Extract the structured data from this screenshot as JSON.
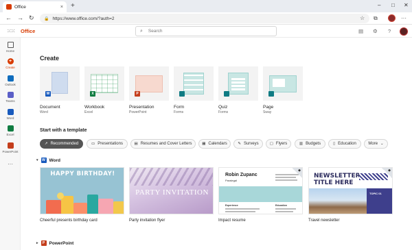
{
  "browser": {
    "tab_title": "Office",
    "url": "https://www.office.com/?auth=2",
    "new_tab": "+",
    "close_tab": "×",
    "window_min": "–",
    "window_max": "□",
    "window_close": "✕",
    "back": "←",
    "forward": "→",
    "refresh": "↻"
  },
  "header": {
    "brand": "Office",
    "search_placeholder": "Search",
    "help": "?"
  },
  "rail": [
    {
      "label": "Home",
      "icon": "home-icon"
    },
    {
      "label": "Create",
      "icon": "create-icon",
      "active": true
    },
    {
      "label": "Outlook",
      "icon": "outlook-icon",
      "color": "#0f6cbd"
    },
    {
      "label": "Teams",
      "icon": "teams-icon",
      "color": "#5b5fc7"
    },
    {
      "label": "Word",
      "icon": "word-icon",
      "color": "#185abd"
    },
    {
      "label": "Excel",
      "icon": "excel-icon",
      "color": "#107c41"
    },
    {
      "label": "PowerPoint",
      "icon": "powerpoint-icon",
      "color": "#c43e1c"
    },
    {
      "label": "···",
      "icon": "more-apps-icon"
    }
  ],
  "create": {
    "heading": "Create",
    "items": [
      {
        "name": "Document",
        "app": "Word",
        "badge": "W",
        "color": "#185abd"
      },
      {
        "name": "Workbook",
        "app": "Excel",
        "badge": "X",
        "color": "#107c41"
      },
      {
        "name": "Presentation",
        "app": "PowerPoint",
        "badge": "P",
        "color": "#c43e1c"
      },
      {
        "name": "Form",
        "app": "Forms",
        "badge": "",
        "color": "#0f7b83"
      },
      {
        "name": "Quiz",
        "app": "Forms",
        "badge": "",
        "color": "#0f7b83"
      },
      {
        "name": "Page",
        "app": "Sway",
        "badge": "",
        "color": "#0f7b83"
      }
    ]
  },
  "templates": {
    "heading": "Start with a template",
    "filters": [
      "Recommended",
      "Presentations",
      "Resumes and Cover Letters",
      "Calendars",
      "Surveys",
      "Flyers",
      "Budgets",
      "Education",
      "More"
    ],
    "word_section": "Word",
    "ppt_section": "PowerPoint",
    "cards": [
      {
        "name": "Cheerful presents birthday card",
        "art_text": "HAPPY BIRTHDAY!"
      },
      {
        "name": "Party invitation flyer",
        "art_text": "PARTY INVITATION"
      },
      {
        "name": "Impact resume",
        "art_text": "Robin Zupanc",
        "art_sub": "Paralegal",
        "art_lbl1": "Experience",
        "art_lbl2": "Education"
      },
      {
        "name": "Travel newsletter",
        "art_text": "NEWSLETTER TITLE HERE",
        "art_side": "TOPIC 01"
      }
    ]
  },
  "colors": {
    "accent": "#d83b01"
  }
}
